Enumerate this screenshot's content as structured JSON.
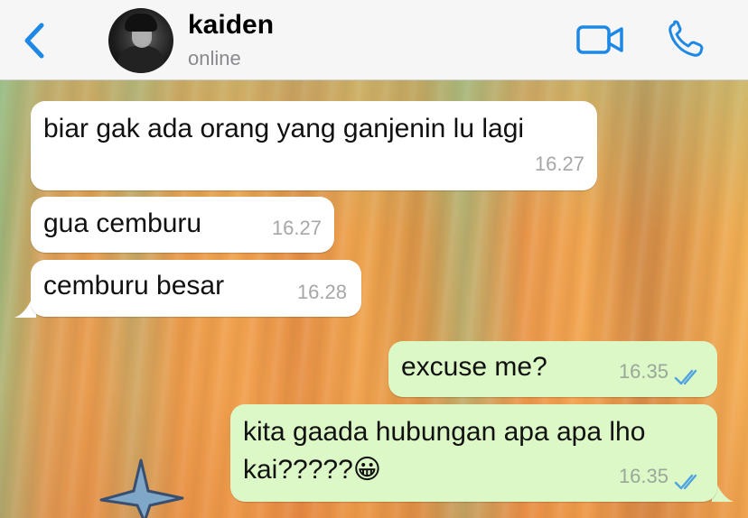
{
  "header": {
    "contact_name": "kaiden",
    "status": "online",
    "accent_color": "#1e88e5"
  },
  "icons": [
    "back-chevron-icon",
    "avatar-photo",
    "video-camera-icon",
    "phone-icon",
    "double-check-read-icon"
  ],
  "messages": [
    {
      "direction": "incoming",
      "text": "biar gak ada orang yang ganjenin lu lagi",
      "time": "16.27"
    },
    {
      "direction": "incoming",
      "text": "gua cemburu",
      "time": "16.27"
    },
    {
      "direction": "incoming",
      "text": "cemburu besar",
      "time": "16.28"
    },
    {
      "direction": "outgoing",
      "text": "excuse me?",
      "time": "16.35",
      "status": "read"
    },
    {
      "direction": "outgoing",
      "text_line1": "kita gaada hubungan apa apa lho",
      "text_line2": "kai?????",
      "emoji": "😀",
      "time": "16.35",
      "status": "read"
    }
  ],
  "colors": {
    "incoming_bubble": "#ffffff",
    "outgoing_bubble": "#dcf8c6",
    "read_ticks": "#4fa3e0"
  }
}
